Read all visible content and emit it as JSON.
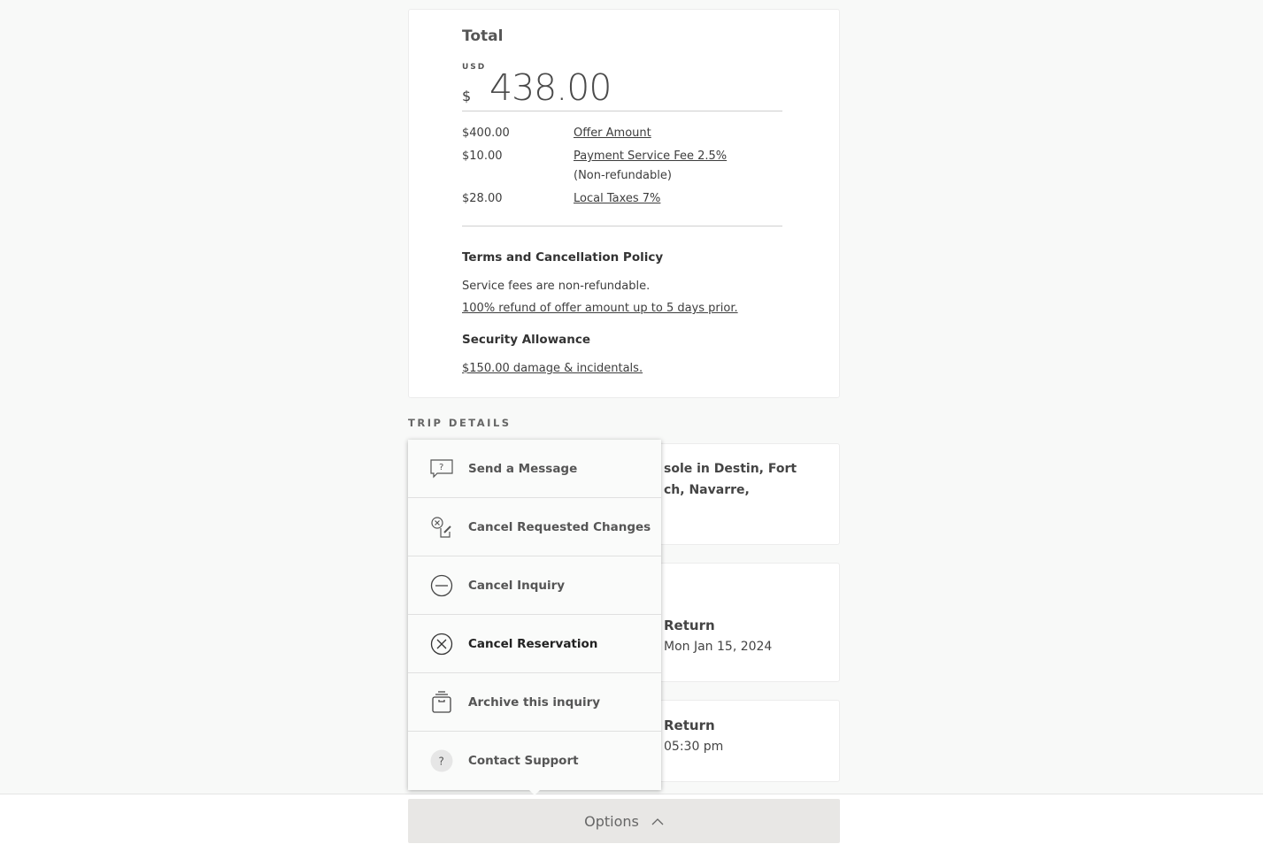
{
  "total": {
    "title": "Total",
    "currency": "USD",
    "symbol": "$",
    "amount": "438.00",
    "lines": [
      {
        "value": "$400.00",
        "label": "Offer Amount"
      },
      {
        "value": "$10.00",
        "label": "Payment Service Fee 2.5%",
        "note": "(Non-refundable)"
      },
      {
        "value": "$28.00",
        "label": "Local Taxes 7%"
      }
    ],
    "terms_heading": "Terms and Cancellation Policy",
    "terms_text": "Service fees are non-refundable.",
    "terms_link": "100% refund of offer amount up to 5 days prior.",
    "security_heading": "Security Allowance",
    "security_link": "$150.00 damage & incidentals."
  },
  "trip": {
    "label": "TRIP DETAILS",
    "listing_line1": "sole in Destin, Fort",
    "listing_line2": "ch, Navarre,",
    "return_date_label": "Return",
    "return_date": "Mon Jan 15, 2024",
    "return_time_label": "Return",
    "return_time": "05:30 pm"
  },
  "menu": [
    {
      "label": "Send a Message",
      "icon": "message-question-icon"
    },
    {
      "label": "Cancel Requested Changes",
      "icon": "cancel-edit-icon"
    },
    {
      "label": "Cancel Inquiry",
      "icon": "minus-circle-icon"
    },
    {
      "label": "Cancel Reservation",
      "icon": "x-circle-icon"
    },
    {
      "label": "Archive this inquiry",
      "icon": "archive-box-icon"
    },
    {
      "label": "Contact Support",
      "icon": "question-circle-icon"
    }
  ],
  "footer": {
    "options_label": "Options",
    "icon": "chevron-up-icon"
  }
}
